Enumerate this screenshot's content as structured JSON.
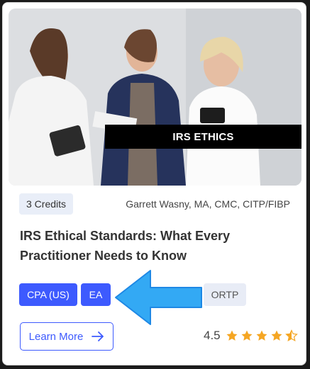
{
  "course": {
    "banner": "IRS ETHICS",
    "credits": "3 Credits",
    "author": "Garrett Wasny, MA, CMC, CITP/FIBP",
    "title": "IRS Ethical Standards: What Every Practitioner Needs to Know",
    "tags": [
      "CPA (US)",
      "EA",
      "ORTP"
    ],
    "learn_more": "Learn More",
    "rating": "4.5",
    "rating_value": 4.5,
    "rating_max": 5
  },
  "colors": {
    "accent": "#3d5afe",
    "star": "#f5a623",
    "annotation_arrow": "#33a9f4"
  },
  "icons": [
    "arrow-right-icon",
    "star-icon",
    "half-star-icon"
  ]
}
